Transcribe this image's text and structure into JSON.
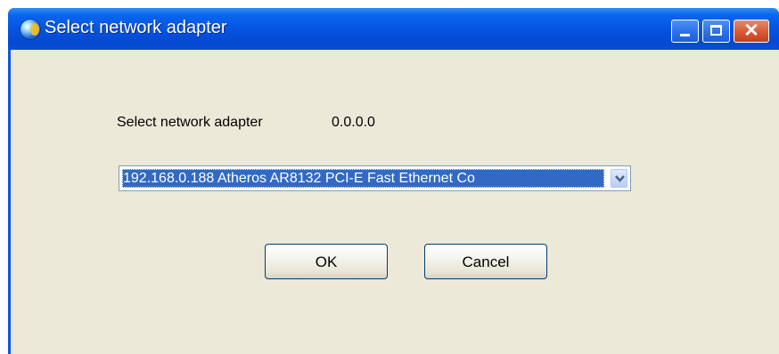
{
  "window": {
    "title": "Select network adapter",
    "controls": {
      "minimize": "minimize",
      "maximize": "maximize",
      "close": "✕"
    }
  },
  "dialog": {
    "label": "Select network adapter",
    "ip_value": "0.0.0.0",
    "adapter_select": {
      "selected": "192.168.0.188 Atheros AR8132 PCI-E Fast Ethernet Co"
    },
    "ok_label": "OK",
    "cancel_label": "Cancel"
  },
  "colors": {
    "titlebar": "#0552de",
    "client_bg": "#ece9d8",
    "selection": "#316ac5",
    "close_button": "#d65a35"
  },
  "icons": [
    "app-globe-icon",
    "minimize-icon",
    "maximize-icon",
    "close-icon",
    "chevron-down-icon"
  ]
}
